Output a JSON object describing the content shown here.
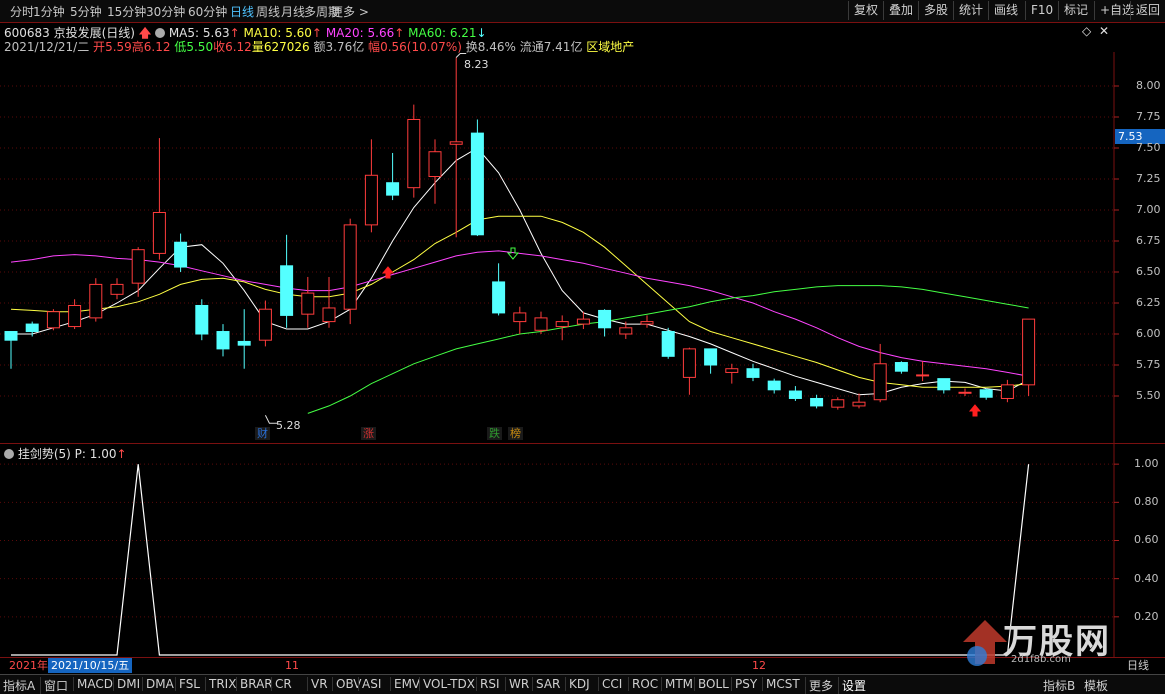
{
  "toolbar": {
    "periods": [
      {
        "label": "分时",
        "active": false
      },
      {
        "label": "1分钟",
        "active": false
      },
      {
        "label": "5分钟",
        "active": false
      },
      {
        "label": "15分钟",
        "active": false
      },
      {
        "label": "30分钟",
        "active": false
      },
      {
        "label": "60分钟",
        "active": false
      },
      {
        "label": "日线",
        "active": true
      },
      {
        "label": "周线",
        "active": false
      },
      {
        "label": "月线",
        "active": false
      },
      {
        "label": "多周期",
        "active": false
      },
      {
        "label": "更多",
        "active": false
      }
    ],
    "right_buttons": [
      "复权",
      "叠加",
      "多股",
      "统计",
      "画线",
      "F10",
      "标记",
      "+自选",
      "返回"
    ]
  },
  "stock": {
    "code_name": "600683 京投发展(日线)",
    "ma5_label": "MA5: 5.63",
    "ma10_label": "MA10: 5.60",
    "ma20_label": "MA20: 5.66",
    "ma60_label": "MA60: 6.21",
    "date": "2021/12/21/二",
    "open_label": "开",
    "open": "5.59",
    "high_label": "高",
    "high": "6.12",
    "low_label": "低",
    "low": "5.50",
    "close_label": "收",
    "close": "6.12",
    "volume_label": "量",
    "volume": "627026",
    "amount_label": "额",
    "amount": "3.76亿",
    "change_label": "幅",
    "change": "0.56(10.07%)",
    "turnover_label": "换",
    "turnover": "8.46%",
    "float_label": "流通",
    "float_cap": "7.41亿",
    "sector": "区域地产"
  },
  "main_chart": {
    "y_ticks": [
      "8.00",
      "7.75",
      "7.50",
      "7.25",
      "7.00",
      "6.75",
      "6.50",
      "6.25",
      "6.00",
      "5.75",
      "5.50"
    ],
    "current_price": "7.53",
    "high_marker": "8.23",
    "low_marker": "5.28",
    "event_tags": [
      {
        "text": "财",
        "color": "#2a6fd6"
      },
      {
        "text": "涨",
        "color": "#d03030"
      },
      {
        "text": "跌",
        "color": "#2f9a2f"
      },
      {
        "text": "榜",
        "color": "#c88a10"
      }
    ]
  },
  "indicator": {
    "name": "挂剑势(5)",
    "value_label": "P: 1.00",
    "y_ticks": [
      "1.00",
      "0.80",
      "0.60",
      "0.40",
      "0.20"
    ]
  },
  "date_axis": {
    "year_label": "2021年",
    "cursor_date": "2021/10/15/五",
    "month_11": "11",
    "month_12": "12",
    "period": "日线"
  },
  "tabs": {
    "left_label": "指标A",
    "window_label": "窗口",
    "items": [
      "MACD",
      "DMI",
      "DMA",
      "FSL",
      "TRIX",
      "BRAR",
      "CR",
      "VR",
      "OBV",
      "ASI",
      "EMV",
      "VOL-TDX",
      "RSI",
      "WR",
      "SAR",
      "KDJ",
      "CCI",
      "ROC",
      "MTM",
      "BOLL",
      "PSY",
      "MCST",
      "更多",
      "设置"
    ],
    "right_label": "指标B",
    "mode_label": "模板"
  },
  "watermark": {
    "text": "万股网",
    "url": "2d1f8b.com"
  },
  "colors": {
    "up": "#ff3c3c",
    "down": "#54ffff",
    "ma5": "#ffffff",
    "ma10": "#ffff44",
    "ma20": "#ff44ff",
    "ma60": "#44ff44",
    "grid": "#7a1010"
  },
  "chart_data": [
    {
      "type": "candlestick",
      "title": "600683 京投发展(日线)",
      "ylim": [
        5.3,
        8.3
      ],
      "candles": [
        [
          6.02,
          5.95,
          6.02,
          5.72
        ],
        [
          6.08,
          6.02,
          6.1,
          5.98
        ],
        [
          6.05,
          6.18,
          6.2,
          6.03
        ],
        [
          6.06,
          6.23,
          6.28,
          6.04
        ],
        [
          6.13,
          6.4,
          6.45,
          6.1
        ],
        [
          6.32,
          6.4,
          6.45,
          6.28
        ],
        [
          6.41,
          6.68,
          6.7,
          6.3
        ],
        [
          6.65,
          6.98,
          7.58,
          6.6
        ],
        [
          6.74,
          6.54,
          6.81,
          6.5
        ],
        [
          6.23,
          6.0,
          6.28,
          5.95
        ],
        [
          6.02,
          5.88,
          6.08,
          5.82
        ],
        [
          5.94,
          5.91,
          6.2,
          5.72
        ],
        [
          5.95,
          6.2,
          6.27,
          5.9
        ],
        [
          6.55,
          6.15,
          6.8,
          6.05
        ],
        [
          6.16,
          6.33,
          6.46,
          6.05
        ],
        [
          6.1,
          6.21,
          6.46,
          6.05
        ],
        [
          6.2,
          6.88,
          6.93,
          6.08
        ],
        [
          6.88,
          7.28,
          7.57,
          6.82
        ],
        [
          7.22,
          7.12,
          7.46,
          7.08
        ],
        [
          7.18,
          7.73,
          7.85,
          7.1
        ],
        [
          7.27,
          7.47,
          7.57,
          7.05
        ],
        [
          7.53,
          7.55,
          8.23,
          6.78
        ],
        [
          7.62,
          6.8,
          7.73,
          6.79
        ],
        [
          6.42,
          6.17,
          6.57,
          6.15
        ],
        [
          6.1,
          6.17,
          6.22,
          6.0
        ],
        [
          6.03,
          6.13,
          6.18,
          6.0
        ],
        [
          6.06,
          6.1,
          6.15,
          5.95
        ],
        [
          6.08,
          6.12,
          6.18,
          6.04
        ],
        [
          6.19,
          6.05,
          6.2,
          5.98
        ],
        [
          6.0,
          6.05,
          6.1,
          5.96
        ],
        [
          6.08,
          6.1,
          6.15,
          6.05
        ],
        [
          6.02,
          5.82,
          6.05,
          5.8
        ],
        [
          5.65,
          5.88,
          5.89,
          5.51
        ],
        [
          5.88,
          5.75,
          5.88,
          5.68
        ],
        [
          5.69,
          5.72,
          5.76,
          5.6
        ],
        [
          5.72,
          5.65,
          5.76,
          5.62
        ],
        [
          5.62,
          5.55,
          5.64,
          5.52
        ],
        [
          5.54,
          5.48,
          5.58,
          5.46
        ],
        [
          5.48,
          5.42,
          5.51,
          5.4
        ],
        [
          5.41,
          5.47,
          5.49,
          5.39
        ],
        [
          5.42,
          5.45,
          5.52,
          5.4
        ],
        [
          5.47,
          5.76,
          5.92,
          5.45
        ],
        [
          5.77,
          5.7,
          5.78,
          5.68
        ],
        [
          5.67,
          5.67,
          5.78,
          5.62
        ],
        [
          5.64,
          5.55,
          5.64,
          5.52
        ],
        [
          5.53,
          5.53,
          5.56,
          5.5
        ],
        [
          5.55,
          5.49,
          5.56,
          5.47
        ],
        [
          5.48,
          5.59,
          5.63,
          5.45
        ],
        [
          5.59,
          6.12,
          6.12,
          5.5
        ]
      ],
      "series": [
        {
          "name": "MA5",
          "values": [
            6.0,
            6.0,
            6.05,
            6.1,
            6.16,
            6.25,
            6.35,
            6.53,
            6.7,
            6.72,
            6.57,
            6.35,
            6.1,
            6.04,
            6.04,
            6.1,
            6.2,
            6.45,
            6.75,
            7.02,
            7.22,
            7.4,
            7.5,
            7.3,
            7.0,
            6.65,
            6.35,
            6.17,
            6.12,
            6.08,
            6.08,
            6.03,
            5.98,
            5.92,
            5.85,
            5.78,
            5.72,
            5.66,
            5.61,
            5.56,
            5.51,
            5.52,
            5.57,
            5.6,
            5.62,
            5.61,
            5.56,
            5.54,
            5.63
          ]
        },
        {
          "name": "MA10",
          "values": [
            6.2,
            6.19,
            6.18,
            6.18,
            6.2,
            6.22,
            6.26,
            6.32,
            6.4,
            6.44,
            6.45,
            6.42,
            6.36,
            6.32,
            6.3,
            6.3,
            6.33,
            6.4,
            6.5,
            6.6,
            6.73,
            6.82,
            6.92,
            6.95,
            6.95,
            6.95,
            6.9,
            6.82,
            6.7,
            6.55,
            6.4,
            6.25,
            6.1,
            6.02,
            5.97,
            5.92,
            5.87,
            5.82,
            5.77,
            5.71,
            5.65,
            5.61,
            5.59,
            5.57,
            5.57,
            5.57,
            5.57,
            5.58,
            5.6
          ]
        },
        {
          "name": "MA20",
          "values": [
            6.58,
            6.6,
            6.63,
            6.64,
            6.63,
            6.61,
            6.6,
            6.58,
            6.55,
            6.51,
            6.47,
            6.43,
            6.4,
            6.37,
            6.35,
            6.35,
            6.38,
            6.43,
            6.48,
            6.53,
            6.58,
            6.63,
            6.66,
            6.67,
            6.65,
            6.63,
            6.6,
            6.57,
            6.53,
            6.49,
            6.45,
            6.42,
            6.39,
            6.35,
            6.3,
            6.25,
            6.18,
            6.12,
            6.05,
            5.97,
            5.9,
            5.85,
            5.81,
            5.78,
            5.76,
            5.74,
            5.72,
            5.69,
            5.66
          ]
        },
        {
          "name": "MA60",
          "values": [
            null,
            null,
            null,
            null,
            null,
            null,
            null,
            null,
            null,
            null,
            null,
            null,
            null,
            null,
            5.36,
            5.42,
            5.5,
            5.6,
            5.68,
            5.76,
            5.82,
            5.88,
            5.92,
            5.96,
            6.0,
            6.02,
            6.05,
            6.08,
            6.1,
            6.13,
            6.16,
            6.19,
            6.22,
            6.26,
            6.29,
            6.31,
            6.34,
            6.36,
            6.38,
            6.39,
            6.39,
            6.39,
            6.38,
            6.36,
            6.33,
            6.3,
            6.27,
            6.24,
            6.21
          ]
        }
      ]
    },
    {
      "type": "line",
      "title": "挂剑势(5)",
      "ylim": [
        0,
        1.05
      ],
      "series": [
        {
          "name": "P",
          "values": [
            0,
            0,
            0,
            0,
            0,
            0,
            1,
            0,
            0,
            0,
            0,
            0,
            0,
            0,
            0,
            0,
            0,
            0,
            0,
            0,
            0,
            0,
            0,
            0,
            0,
            0,
            0,
            0,
            0,
            0,
            0,
            0,
            0,
            0,
            0,
            0,
            0,
            0,
            0,
            0,
            0,
            0,
            0,
            0,
            0,
            0,
            0,
            0,
            1
          ]
        }
      ]
    }
  ]
}
